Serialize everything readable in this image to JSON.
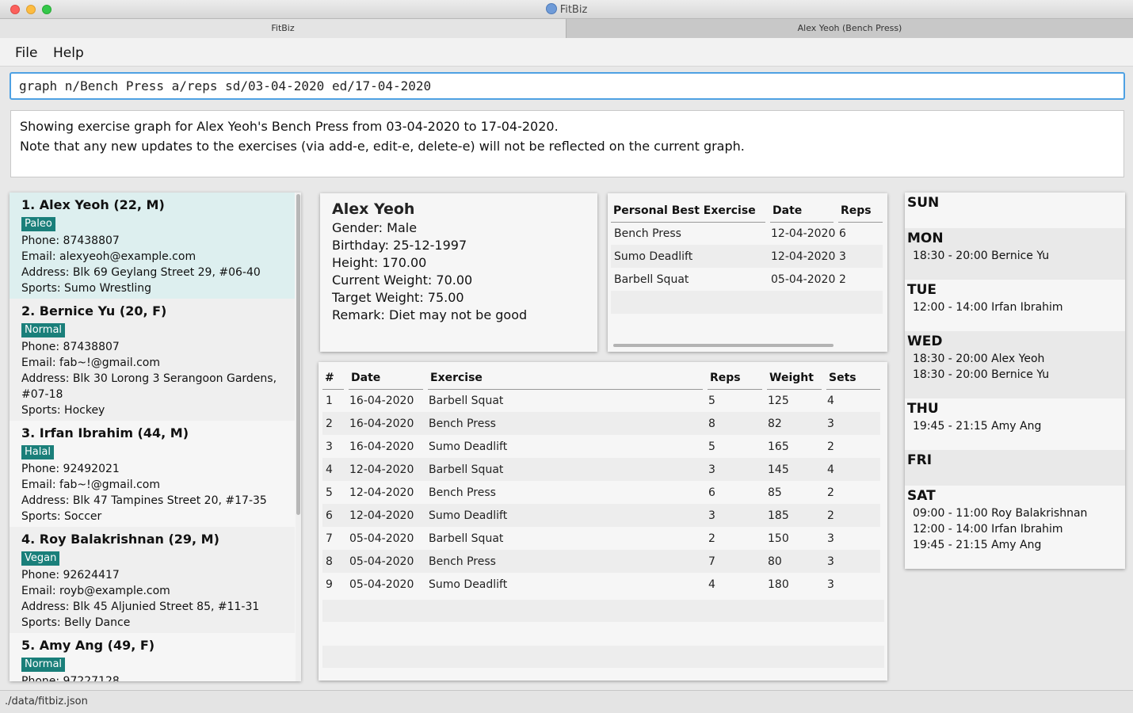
{
  "window": {
    "title": "FitBiz"
  },
  "tabs": [
    {
      "label": "FitBiz"
    },
    {
      "label": "Alex Yeoh (Bench Press)"
    }
  ],
  "menu": {
    "file": "File",
    "help": "Help"
  },
  "command": {
    "value": "graph n/Bench Press a/reps sd/03-04-2020 ed/17-04-2020"
  },
  "result": {
    "line1": "Showing exercise graph for Alex Yeoh's Bench Press from 03-04-2020 to 17-04-2020.",
    "line2": "Note that any new updates to the exercises (via add-e, edit-e, delete-e) will not be reflected on the current graph."
  },
  "persons": [
    {
      "title": "1.  Alex Yeoh (22, M)",
      "tag": "Paleo",
      "phone": "Phone: 87438807",
      "email": "Email: alexyeoh@example.com",
      "address": "Address: Blk 69 Geylang Street 29, #06-40",
      "sports": "Sports: Sumo Wrestling"
    },
    {
      "title": "2.  Bernice Yu (20, F)",
      "tag": "Normal",
      "phone": "Phone: 87438807",
      "email": "Email: fab~!@gmail.com",
      "address": "Address: Blk 30 Lorong 3 Serangoon Gardens,",
      "address2": "#07-18",
      "sports": "Sports: Hockey"
    },
    {
      "title": "3.  Irfan Ibrahim (44, M)",
      "tag": "Halal",
      "phone": "Phone: 92492021",
      "email": "Email: fab~!@gmail.com",
      "address": "Address: Blk 47 Tampines Street 20, #17-35",
      "sports": "Sports: Soccer"
    },
    {
      "title": "4.  Roy Balakrishnan (29, M)",
      "tag": "Vegan",
      "phone": "Phone: 92624417",
      "email": "Email: royb@example.com",
      "address": "Address: Blk 45 Aljunied Street 85, #11-31",
      "sports": "Sports: Belly Dance"
    },
    {
      "title": "5.  Amy Ang (49, F)",
      "tag": "Normal",
      "phone": "Phone: 97227128"
    }
  ],
  "profile": {
    "name": "Alex Yeoh",
    "gender": "Gender: Male",
    "birthday": "Birthday: 25-12-1997",
    "height": "Height: 170.00",
    "current_weight": "Current Weight: 70.00",
    "target_weight": "Target Weight: 75.00",
    "remark": "Remark: Diet may not be good"
  },
  "personal_best": {
    "headers": {
      "exercise": "Personal Best Exercise",
      "date": "Date",
      "reps": "Reps"
    },
    "rows": [
      {
        "exercise": "Bench Press",
        "date": "12-04-2020",
        "reps": "6"
      },
      {
        "exercise": "Sumo Deadlift",
        "date": "12-04-2020",
        "reps": "3"
      },
      {
        "exercise": "Barbell Squat",
        "date": "05-04-2020",
        "reps": "2"
      }
    ]
  },
  "history": {
    "headers": {
      "num": "#",
      "date": "Date",
      "exercise": "Exercise",
      "reps": "Reps",
      "weight": "Weight",
      "sets": "Sets"
    },
    "rows": [
      {
        "num": "1",
        "date": "16-04-2020",
        "exercise": "Barbell Squat",
        "reps": "5",
        "weight": "125",
        "sets": "4"
      },
      {
        "num": "2",
        "date": "16-04-2020",
        "exercise": "Bench Press",
        "reps": "8",
        "weight": "82",
        "sets": "3"
      },
      {
        "num": "3",
        "date": "16-04-2020",
        "exercise": "Sumo Deadlift",
        "reps": "5",
        "weight": "165",
        "sets": "2"
      },
      {
        "num": "4",
        "date": "12-04-2020",
        "exercise": "Barbell Squat",
        "reps": "3",
        "weight": "145",
        "sets": "4"
      },
      {
        "num": "5",
        "date": "12-04-2020",
        "exercise": "Bench Press",
        "reps": "6",
        "weight": "85",
        "sets": "2"
      },
      {
        "num": "6",
        "date": "12-04-2020",
        "exercise": "Sumo Deadlift",
        "reps": "3",
        "weight": "185",
        "sets": "2"
      },
      {
        "num": "7",
        "date": "05-04-2020",
        "exercise": "Barbell Squat",
        "reps": "2",
        "weight": "150",
        "sets": "3"
      },
      {
        "num": "8",
        "date": "05-04-2020",
        "exercise": "Bench Press",
        "reps": "7",
        "weight": "80",
        "sets": "3"
      },
      {
        "num": "9",
        "date": "05-04-2020",
        "exercise": "Sumo Deadlift",
        "reps": "4",
        "weight": "180",
        "sets": "3"
      }
    ]
  },
  "schedule": [
    {
      "day": "SUN",
      "slots": []
    },
    {
      "day": "MON",
      "slots": [
        "18:30 - 20:00 Bernice Yu"
      ]
    },
    {
      "day": "TUE",
      "slots": [
        "12:00 - 14:00 Irfan Ibrahim"
      ]
    },
    {
      "day": "WED",
      "slots": [
        "18:30 - 20:00 Alex Yeoh",
        "18:30 - 20:00 Bernice Yu"
      ]
    },
    {
      "day": "THU",
      "slots": [
        "19:45 - 21:15 Amy Ang"
      ]
    },
    {
      "day": "FRI",
      "slots": []
    },
    {
      "day": "SAT",
      "slots": [
        "09:00 - 11:00 Roy Balakrishnan",
        "12:00 - 14:00 Irfan Ibrahim",
        "19:45 - 21:15 Amy Ang"
      ]
    }
  ],
  "status": {
    "path": "./data/fitbiz.json"
  },
  "colors": {
    "accent": "#4ea1e3",
    "tag": "#1a7f7a",
    "selected": "#ddefef"
  }
}
